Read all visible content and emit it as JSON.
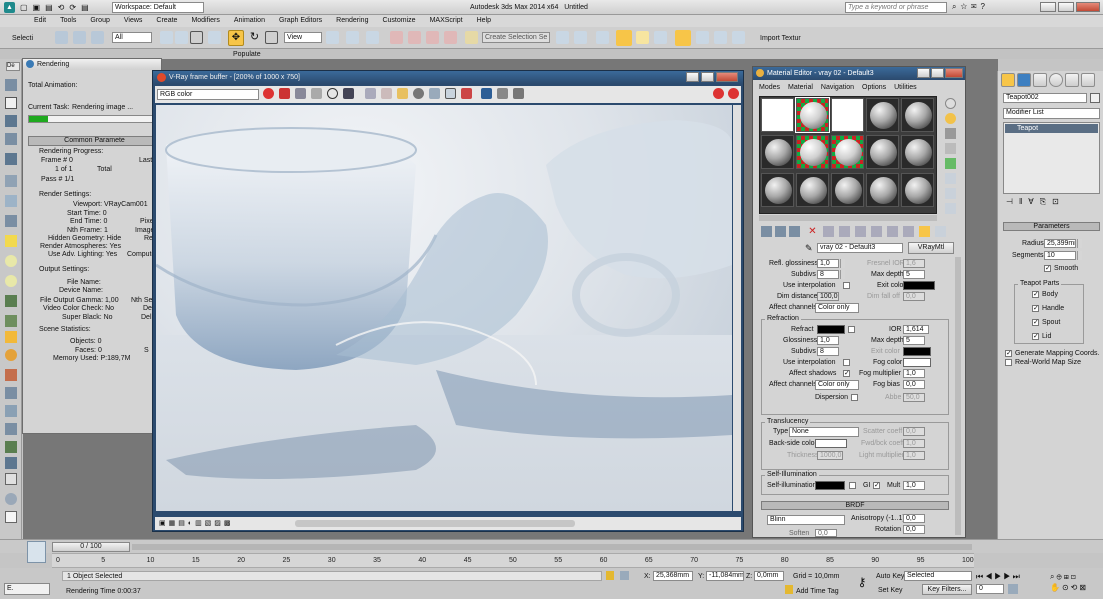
{
  "app": {
    "title": "Autodesk 3ds Max 2014 x64",
    "file": "Untitled",
    "workspace": "Workspace: Default",
    "search_placeholder": "Type a keyword or phrase"
  },
  "menu": [
    "Edit",
    "Tools",
    "Group",
    "Views",
    "Create",
    "Modifiers",
    "Animation",
    "Graph Editors",
    "Rendering",
    "Customize",
    "MAXScript",
    "Help"
  ],
  "toolbar": {
    "select_label": "Selecti",
    "filter": "All",
    "view": "View",
    "selection_set": "Create Selection Se",
    "populate_tab": "Populate",
    "import_label": "Import Textur"
  },
  "rendering_dialog": {
    "title": "Rendering",
    "total_animation": "Total Animation:",
    "current_task_label": "Current Task:",
    "current_task": "Rendering image ...",
    "progress": 0.15,
    "common_params": "Common Paramete",
    "progress_section": "Rendering Progress:",
    "frame_label": "Frame #",
    "frame_value": "0",
    "last_label": "Last",
    "one_of_one": "1 of 1",
    "total": "Total",
    "pass_label": "Pass #",
    "pass_value": "1/1",
    "render_settings": "Render Settings:",
    "viewport_label": "Viewport:",
    "viewport_value": "VRayCam001",
    "start_time": "Start Time: 0",
    "end_time": "End Time: 0",
    "nth_frame": "Nth Frame: 1",
    "hidden_geometry": "Hidden Geometry: Hide",
    "render_atmos": "Render Atmospheres: Yes",
    "use_adv_lighting": "Use Adv. Lighting: Yes",
    "output_settings": "Output Settings:",
    "file_name": "File Name:",
    "device_name": "Device Name:",
    "file_output_gamma": "File Output Gamma: 1,00",
    "video_color_check": "Video Color Check: No",
    "super_black": "Super Black: No",
    "scene_statistics": "Scene Statistics:",
    "objects": "Objects: 0",
    "faces": "Faces: 0",
    "memory_used": "Memory Used: P:189,7M",
    "col2": [
      "Pixel",
      "Image",
      "Re",
      "Computer",
      "Nth Ser",
      "De",
      "Del",
      "S"
    ]
  },
  "vfb": {
    "title": "V-Ray frame buffer - [200% of 1000 x 750]",
    "channel": "RGB color"
  },
  "material_editor": {
    "title": "Material Editor - vray 02 - Default3",
    "menu": [
      "Modes",
      "Material",
      "Navigation",
      "Options",
      "Utilities"
    ],
    "material_name": "vray 02 - Default3",
    "material_type": "VRayMtl",
    "reflection": {
      "refl_glossiness_label": "Refl. glossiness",
      "refl_glossiness": "1,0",
      "fresnel_ior_label": "Fresnel IOR",
      "fresnel_ior": "1,6",
      "subdivs_label": "Subdivs",
      "subdivs": "8",
      "max_depth_label": "Max depth",
      "max_depth": "5",
      "use_interp": "Use interpolation",
      "exit_color": "Exit color",
      "dim_distance_label": "Dim distance",
      "dim_distance": "100,0",
      "dim_falloff_label": "Dim fall off",
      "dim_falloff": "0,0",
      "affect_channels": "Affect channels",
      "affect_channels_value": "Color only"
    },
    "refraction": {
      "section": "Refraction",
      "refract_label": "Refract",
      "ior_label": "IOR",
      "ior": "1,614",
      "glossiness_label": "Glossiness",
      "glossiness": "1,0",
      "max_depth_label": "Max depth",
      "max_depth": "5",
      "subdivs_label": "Subdivs",
      "subdivs": "8",
      "exit_color": "Exit color",
      "use_interp": "Use interpolation",
      "fog_color": "Fog color",
      "affect_shadows": "Affect shadows",
      "fog_multiplier_label": "Fog multiplier",
      "fog_multiplier": "1,0",
      "affect_channels": "Affect channels",
      "affect_channels_value": "Color only",
      "fog_bias_label": "Fog bias",
      "fog_bias": "0,0",
      "dispersion": "Dispersion",
      "abbe_label": "Abbe",
      "abbe": "50,0"
    },
    "translucency": {
      "section": "Translucency",
      "type_label": "Type",
      "type_value": "None",
      "scatter_coeff": "Scatter coeff",
      "scatter_value": "0,0",
      "back_side_color": "Back-side color",
      "fwd_bck_coeff": "Fwd/bck coeff",
      "fwd_value": "1,0",
      "thickness_label": "Thickness",
      "thickness": "1000,0",
      "light_multiplier": "Light multiplier",
      "light_value": "1,0"
    },
    "self_illumination": {
      "section": "Self-Illumination",
      "label": "Self-illumination",
      "gi": "GI",
      "mult_label": "Mult",
      "mult": "1,0"
    },
    "brdf": {
      "section": "BRDF",
      "type": "Blinn",
      "anisotropy_label": "Anisotropy (-1..1)",
      "anisotropy": "0,0",
      "rotation_label": "Rotation",
      "rotation": "0,0",
      "soften_label": "Soften",
      "soften": "0,0"
    }
  },
  "command_panel": {
    "object_name": "Teapot002",
    "modifier_list": "Modifier List",
    "stack_item": "Teapot",
    "parameters": "Parameters",
    "radius_label": "Radius:",
    "radius": "25,399mm",
    "segments_label": "Segments:",
    "segments": "10",
    "smooth": "Smooth",
    "teapot_parts": "Teapot Parts",
    "parts": [
      "Body",
      "Handle",
      "Spout",
      "Lid"
    ],
    "gen_mapping": "Generate Mapping Coords.",
    "real_world": "Real-World Map Size"
  },
  "timeline": {
    "slider": "0 / 100",
    "ticks": [
      "0",
      "5",
      "10",
      "15",
      "20",
      "25",
      "30",
      "35",
      "40",
      "45",
      "50",
      "55",
      "60",
      "65",
      "70",
      "75",
      "80",
      "85",
      "90",
      "95",
      "100"
    ]
  },
  "status": {
    "selection": "1 Object Selected",
    "render_time": "Rendering Time 0:00:37",
    "x": "25,368mm",
    "y": "-11,084mm",
    "z": "0,0mm",
    "grid": "Grid = 10,0mm",
    "add_time_tag": "Add Time Tag",
    "auto_key": "Auto Key",
    "auto_key_mode": "Selected",
    "set_key": "Set Key",
    "key_filters": "Key Filters...",
    "frame": "0"
  },
  "colors": {
    "background": "#c5c5c5",
    "titlebar": "#dcdcdc",
    "vfb_frame": "#2b4a6e",
    "active_icon": "#f7c548",
    "progress_green": "#1fa91f"
  }
}
